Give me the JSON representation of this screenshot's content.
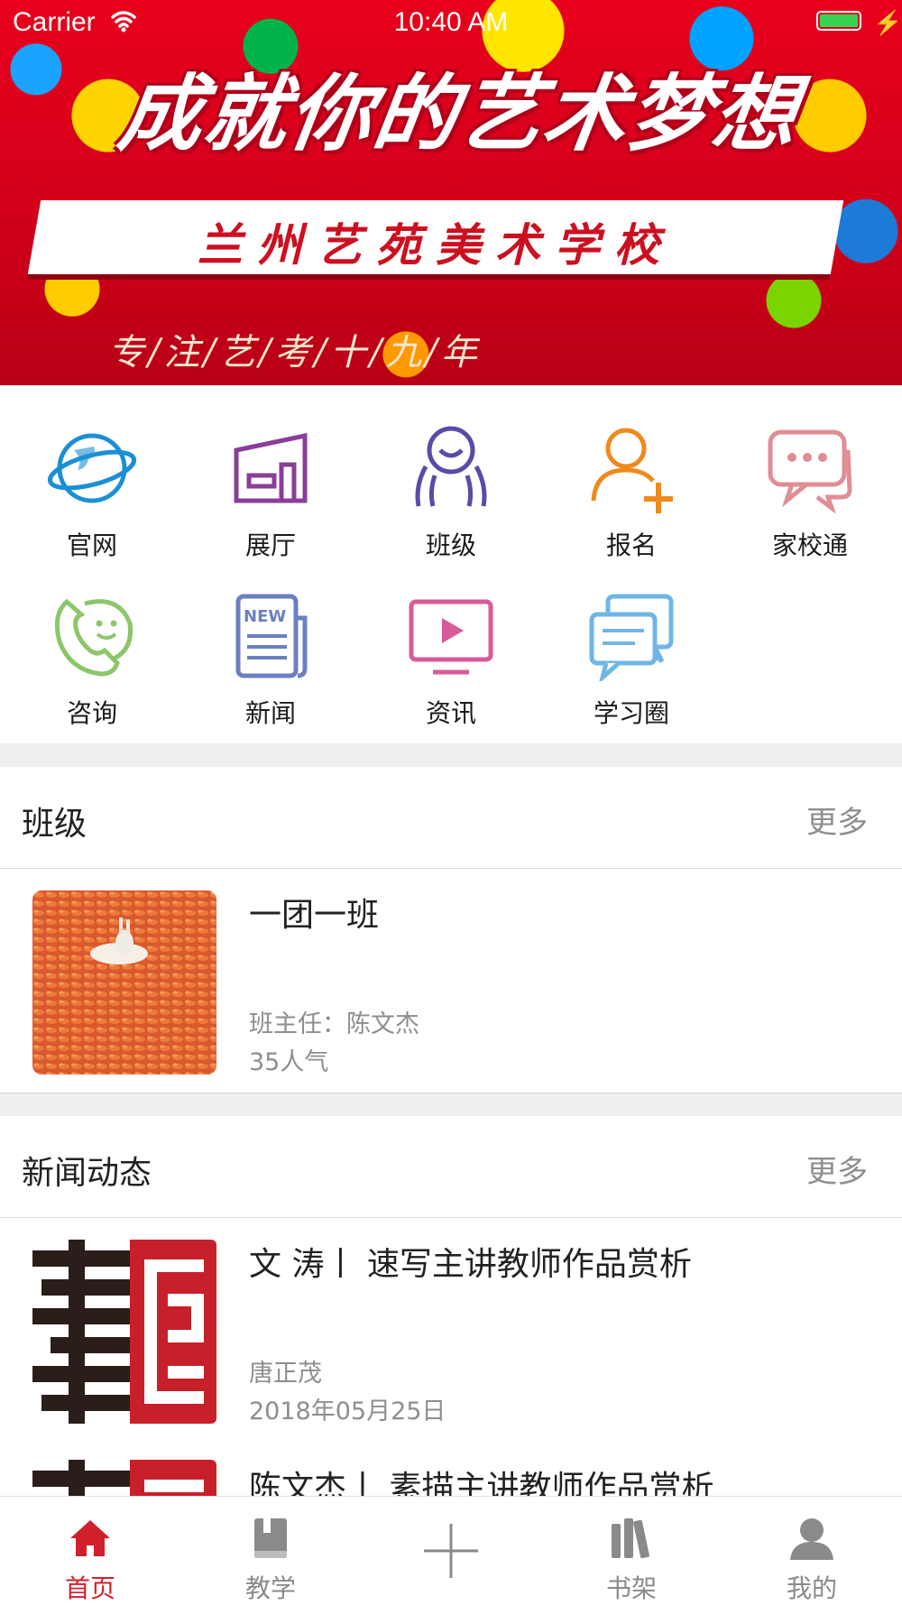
{
  "status_bar": {
    "carrier": "Carrier",
    "time": "10:40 AM"
  },
  "banner": {
    "headline": "成就你的艺术梦想",
    "school": "兰州艺苑美术学校",
    "slogan": "专/注/艺/考/十/九/年"
  },
  "grid": {
    "items": [
      {
        "label": "官网",
        "icon": "globe-icon"
      },
      {
        "label": "展厅",
        "icon": "gallery-icon"
      },
      {
        "label": "班级",
        "icon": "class-icon"
      },
      {
        "label": "报名",
        "icon": "add-user-icon"
      },
      {
        "label": "家校通",
        "icon": "chat-bubbles-icon"
      },
      {
        "label": "咨询",
        "icon": "phone-icon"
      },
      {
        "label": "新闻",
        "icon": "newspaper-icon"
      },
      {
        "label": "资讯",
        "icon": "video-icon"
      },
      {
        "label": "学习圈",
        "icon": "messages-icon"
      }
    ]
  },
  "class_section": {
    "title": "班级",
    "more": "更多",
    "item": {
      "name": "一团一班",
      "teacher": "班主任：陈文杰",
      "popularity": "35人气"
    }
  },
  "news_section": {
    "title": "新闻动态",
    "more": "更多",
    "items": [
      {
        "title": "文 涛丨 速写主讲教师作品赏析",
        "author": "唐正茂",
        "date": "2018年05月25日"
      },
      {
        "title": "陈文杰丨 素描主讲教师作品赏析"
      }
    ]
  },
  "tab_bar": {
    "tabs": [
      {
        "label": "首页",
        "icon": "home-icon",
        "active": true
      },
      {
        "label": "教学",
        "icon": "book-icon"
      },
      {
        "label": "",
        "icon": "plus-icon"
      },
      {
        "label": "书架",
        "icon": "bookshelf-icon"
      },
      {
        "label": "我的",
        "icon": "user-icon"
      }
    ]
  },
  "colors": {
    "accent": "#d0202c",
    "muted": "#8e8e8e",
    "separator": "#efefef"
  }
}
